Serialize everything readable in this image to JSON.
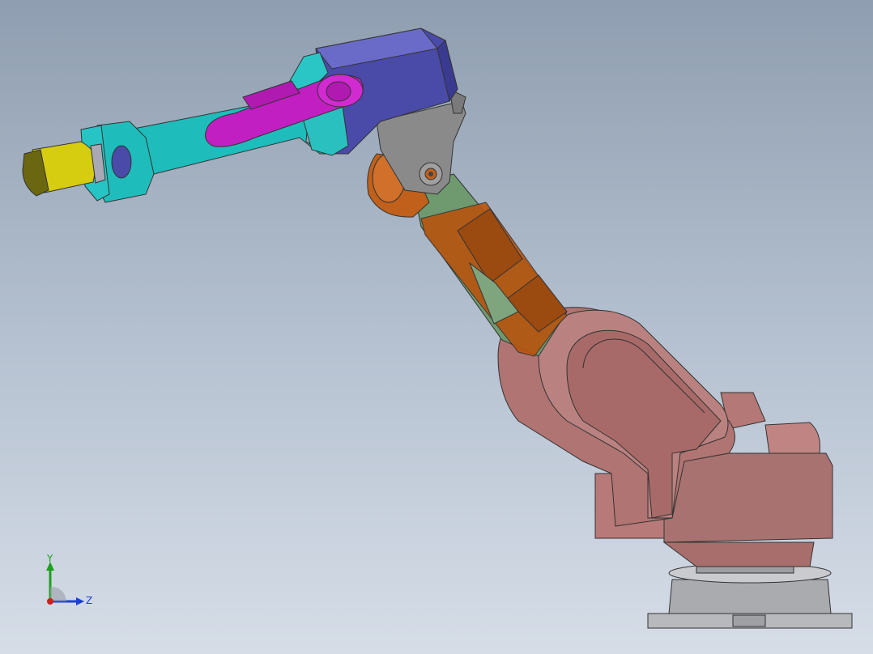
{
  "scene": {
    "type": "cad-3d-viewport",
    "model": "six-axis-robot-arm",
    "colors": {
      "background_top": "#8f9eb0",
      "background_bottom": "#d6dde7",
      "gripper_yellow": "#d6cc10",
      "wrist_cyan": "#1fbcbc",
      "hose_magenta": "#c21fc2",
      "motor_blue": "#4a4aa8",
      "bracket_gray": "#8a8a8a",
      "link_green": "#6f9a6f",
      "link_orange": "#b8540f",
      "base_pink": "#b87a78",
      "pedestal_gray": "#a9abaf"
    }
  },
  "triad": {
    "y_label": "Y",
    "z_label": "Z",
    "colors": {
      "y": "#1fa01f",
      "z": "#1f3fd0",
      "x": "#d01f1f"
    }
  }
}
